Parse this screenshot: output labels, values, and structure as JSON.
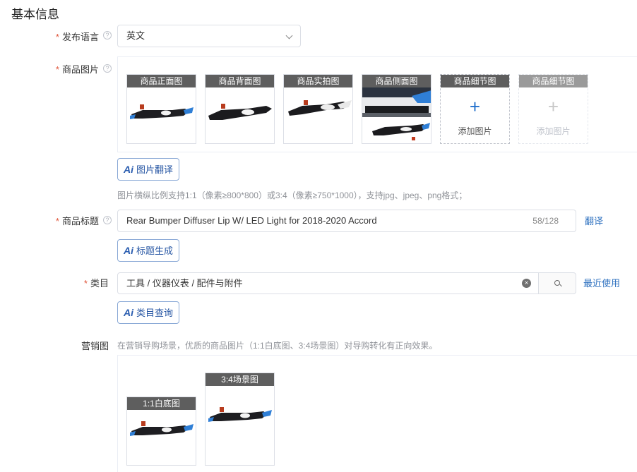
{
  "section": {
    "title": "基本信息"
  },
  "language": {
    "required_mark": "*",
    "label": "发布语言",
    "help": "?",
    "value": "英文"
  },
  "images": {
    "required_mark": "*",
    "label": "商品图片",
    "help": "?",
    "cards": [
      {
        "caption": "商品正面图"
      },
      {
        "caption": "商品背面图"
      },
      {
        "caption": "商品实拍图"
      },
      {
        "caption": "商品侧面图"
      },
      {
        "caption": "商品细节图",
        "add_symbol": "+",
        "add_label": "添加图片"
      },
      {
        "caption": "商品细节图",
        "add_symbol": "+",
        "add_label": "添加图片"
      }
    ],
    "ai_button": {
      "mark": "Ai",
      "label": "图片翻译"
    },
    "hint": "图片横纵比例支持1:1（像素≥800*800）或3:4（像素≥750*1000），支持jpg、jpeg、png格式；"
  },
  "title_field": {
    "required_mark": "*",
    "label": "商品标题",
    "help": "?",
    "value": "Rear Bumper Diffuser Lip W/ LED Light for 2018-2020 Accord",
    "count": "58/128",
    "translate_link": "翻译",
    "ai_button": {
      "mark": "Ai",
      "label": "标题生成"
    }
  },
  "category": {
    "required_mark": "*",
    "label": "类目",
    "value": "工具 / 仪器仪表 / 配件与附件",
    "clear_symbol": "×",
    "recent_link": "最近使用",
    "ai_button": {
      "mark": "Ai",
      "label": "类目查询"
    }
  },
  "marketing": {
    "label": "营销图",
    "hint": "在营销导购场景，优质的商品图片（1:1白底图、3:4场景图）对导购转化有正向效果。",
    "cards": [
      {
        "caption": "1:1白底图"
      },
      {
        "caption": "3:4场景图"
      }
    ]
  },
  "colors": {
    "accent": "#2b6fbf",
    "required": "#e0563b",
    "caption_bg": "#5e5e5e"
  }
}
